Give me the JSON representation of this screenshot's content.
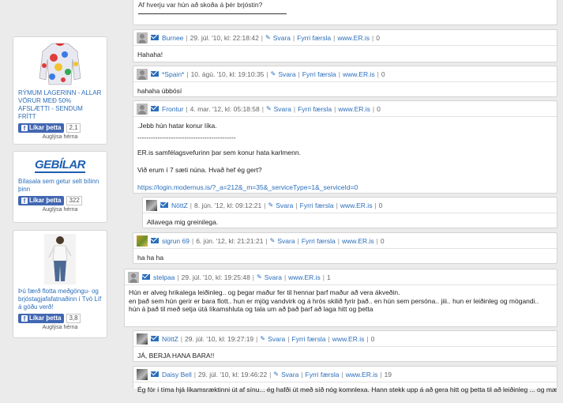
{
  "top_comment": {
    "text": "Af hverju var hún að skoða á þér brjóstin?"
  },
  "ads": [
    {
      "text": "RÝMUM LAGERINN - ALLAR VÖRUR MEÐ 50% AFSLÆTTI - SENDUM FRÍTT",
      "like_label": "Líkar þetta",
      "count": "2,1",
      "footer": "Auglýsa hérna"
    },
    {
      "logo": "GEBÍLAR",
      "text": "Bílasala sem getur selt bílinn þinn",
      "like_label": "Líkar þetta",
      "count": "322",
      "footer": "Auglýsa hérna"
    },
    {
      "text": "Þú færð flotta meðgöngu- og brjóstagjafafatnaðinn í Tvö Líf á góðu verð!",
      "like_label": "Líkar þetta",
      "count": "3,8",
      "footer": "Auglýsa hérna"
    }
  ],
  "comments": [
    {
      "author": "Burnee",
      "date": "29. júl. '10, kl: 22:18:42",
      "reply": "Svara",
      "prev": "Fyrri færsla",
      "site": "www.ER.is",
      "count": "0",
      "body": [
        "Hahaha!"
      ]
    },
    {
      "author": "*Spain*",
      "date": "10. ágú. '10, kl: 19:10:35",
      "reply": "Svara",
      "prev": "Fyrri færsla",
      "site": "www.ER.is",
      "count": "0",
      "body": [
        "hahaha úbbósí"
      ]
    },
    {
      "author": "Frontur",
      "date": "4. mar. '12, kl: 05:18:58",
      "reply": "Svara",
      "prev": "Fyrri færsla",
      "site": "www.ER.is",
      "count": "0",
      "body": [
        ".Jebb hún hatar konur líka.",
        "--------------------------------------------",
        "ER.is samfélagsvefurinn þar sem konur hata karlmenn.",
        "Við erum í 7 sæti núna. Hvað hef ég gert?",
        "https://login.modernus.is/?_a=212&_m=35&_serviceType=1&_serviceId=0"
      ]
    },
    {
      "author": "NöttZ",
      "date": "8. jún. '12, kl: 09:12:21",
      "reply": "Svara",
      "prev": "Fyrri færsla",
      "site": "www.ER.is",
      "count": "0",
      "body": [
        "Allavega mig greinilega."
      ]
    },
    {
      "author": "sigrun 69",
      "date": "6. jún. '12, kl: 21:21:21",
      "reply": "Svara",
      "prev": "Fyrri færsla",
      "site": "www.ER.is",
      "count": "0",
      "body": [
        "ha ha ha"
      ]
    },
    {
      "author": "stelpaa",
      "date": "29. júl. '10, kl: 19:25:48",
      "reply": "Svara",
      "site": "www.ER.is",
      "count": "1",
      "body": [
        "Hún er alveg hrikalega leiðinleg.. og þegar maður fer til hennar þarf maður að vera ákveðin.",
        "en það sem hún gerir er bara flott.. hun er mjög vandvirk og á hrós skilið fyrir það.. en hún sem persóna.. jiii.. hun er leiðinleg og mögandi..",
        "hún á það til með setja útá líkamshluta og tala um að það þarf að laga hitt og þetta"
      ]
    },
    {
      "author": "NöttZ",
      "date": "29. júl. '10, kl: 19:27:19",
      "reply": "Svara",
      "prev": "Fyrri færsla",
      "site": "www.ER.is",
      "count": "0",
      "body": [
        "JÁ, BERJA HANA BARA!!"
      ]
    },
    {
      "author": "Daisy Bell",
      "date": "29. júl. '10, kl: 19:46:22",
      "reply": "Svara",
      "prev": "Fyrri færsla",
      "site": "www.ER.is",
      "count": "19",
      "body": [
        "Ég fór í tíma hjá líkamsræktinni út af sínu... ég hafði út með síð nóg komnlexa. Hann stekk upp á að gera hitt og þetta til að leiðinleg ... og mæla persónur"
      ]
    }
  ]
}
